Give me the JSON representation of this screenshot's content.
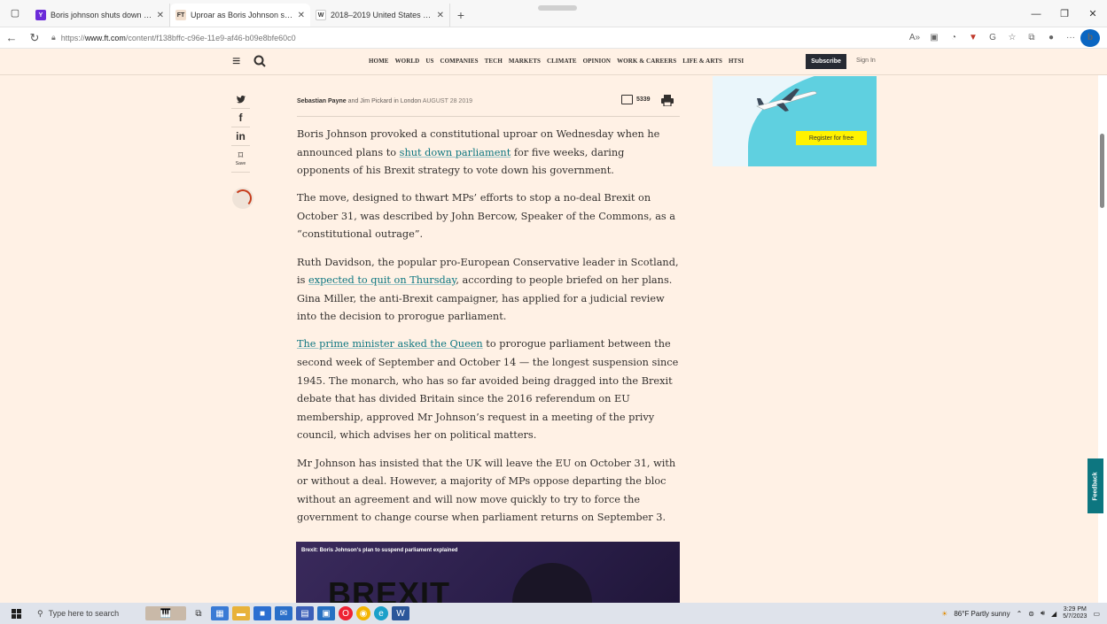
{
  "browser": {
    "tabs": [
      {
        "title": "Boris johnson shuts down fede",
        "favicon": "Y",
        "favicon_color": "#6b2bd9",
        "active": false
      },
      {
        "title": "Uproar as Boris Johnson shuts d",
        "favicon": "FT",
        "favicon_color": "#f2dfce",
        "active": true
      },
      {
        "title": "2018–2019 United States federa",
        "favicon": "W",
        "favicon_color": "#ffffff",
        "active": false
      }
    ],
    "url_prefix": "https://",
    "url_domain": "www.ft.com",
    "url_path": "/content/f138bffc-c96e-11e9-af46-b09e8bfe60c0"
  },
  "ft": {
    "nav": [
      "HOME",
      "WORLD",
      "US",
      "COMPANIES",
      "TECH",
      "MARKETS",
      "CLIMATE",
      "OPINION",
      "WORK & CAREERS",
      "LIFE & ARTS",
      "HTSI"
    ],
    "subscribe_label": "Subscribe",
    "signin_label": "Sign In"
  },
  "share": {
    "twitter": "🐦",
    "facebook": "f",
    "linkedin": "in",
    "save_label": "Save"
  },
  "byline": {
    "author1": "Sebastian Payne",
    "and": "and",
    "author2": "Jim Pickard",
    "location": "in London",
    "date": "AUGUST 28 2019",
    "comment_count": "5339"
  },
  "article": {
    "p1_a": "Boris Johnson provoked a constitutional uproar on Wednesday when he announced plans to ",
    "p1_link": "shut down parliament",
    "p1_b": " for five weeks, daring opponents of his Brexit strategy to vote down his government.",
    "p2": "The move, designed to thwart MPs’ efforts to stop a no-deal Brexit on October 31, was described by John Bercow, Speaker of the Commons, as a “constitutional outrage”.",
    "p3_a": "Ruth Davidson, the popular pro-European Conservative leader in Scotland, is ",
    "p3_link": "expected to quit on Thursday",
    "p3_b": ", according to people briefed on her plans. Gina Miller, the anti-Brexit campaigner, has applied for a judicial review into the decision to prorogue parliament.",
    "p4_link": "The prime minister asked the Queen",
    "p4_b": " to prorogue parliament between the second week of September and October 14 — the longest suspension since 1945. The monarch, who has so far avoided being dragged into the Brexit debate that has divided Britain since the 2016 referendum on EU membership, approved Mr Johnson’s request in a meeting of the privy council, which advises her on political matters.",
    "p5": "Mr Johnson has insisted that the UK will leave the EU on October 31, with or without a deal. However, a majority of MPs oppose departing the bloc without an agreement and will now move quickly to try to force the government to change course when parliament returns on September 3."
  },
  "video": {
    "title": "Brexit: Boris Johnson's plan to suspend parliament explained",
    "big_text": "BREXIT"
  },
  "ad": {
    "cta": "Register for free"
  },
  "feedback_label": "Feedback",
  "taskbar": {
    "search_placeholder": "Type here to search",
    "weather": "86°F  Partly sunny",
    "time": "3:29 PM",
    "date": "5/7/2023"
  }
}
